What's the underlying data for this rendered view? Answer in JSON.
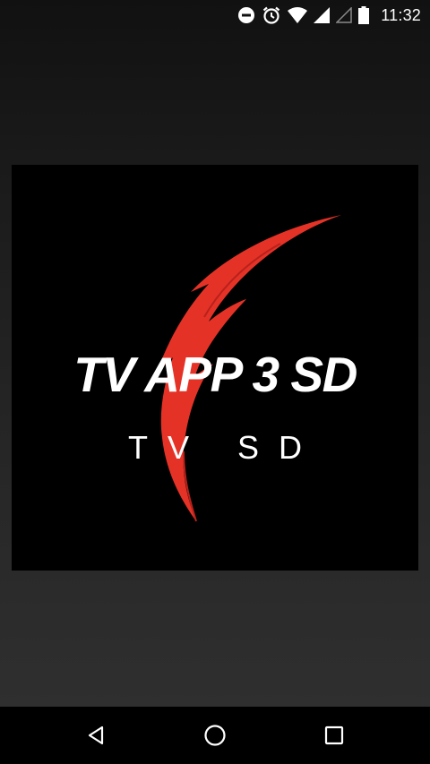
{
  "status_bar": {
    "time": "11:32",
    "icons": [
      "do-not-disturb-icon",
      "alarm-icon",
      "wifi-icon",
      "signal-icon",
      "signal-empty-icon",
      "battery-icon"
    ]
  },
  "splash": {
    "title": "TV APP 3 SD",
    "subtitle": "TV SD",
    "accent_color": "#e53227",
    "background_color": "#000000"
  },
  "nav_bar": {
    "buttons": [
      "back-icon",
      "home-icon",
      "recents-icon"
    ]
  }
}
